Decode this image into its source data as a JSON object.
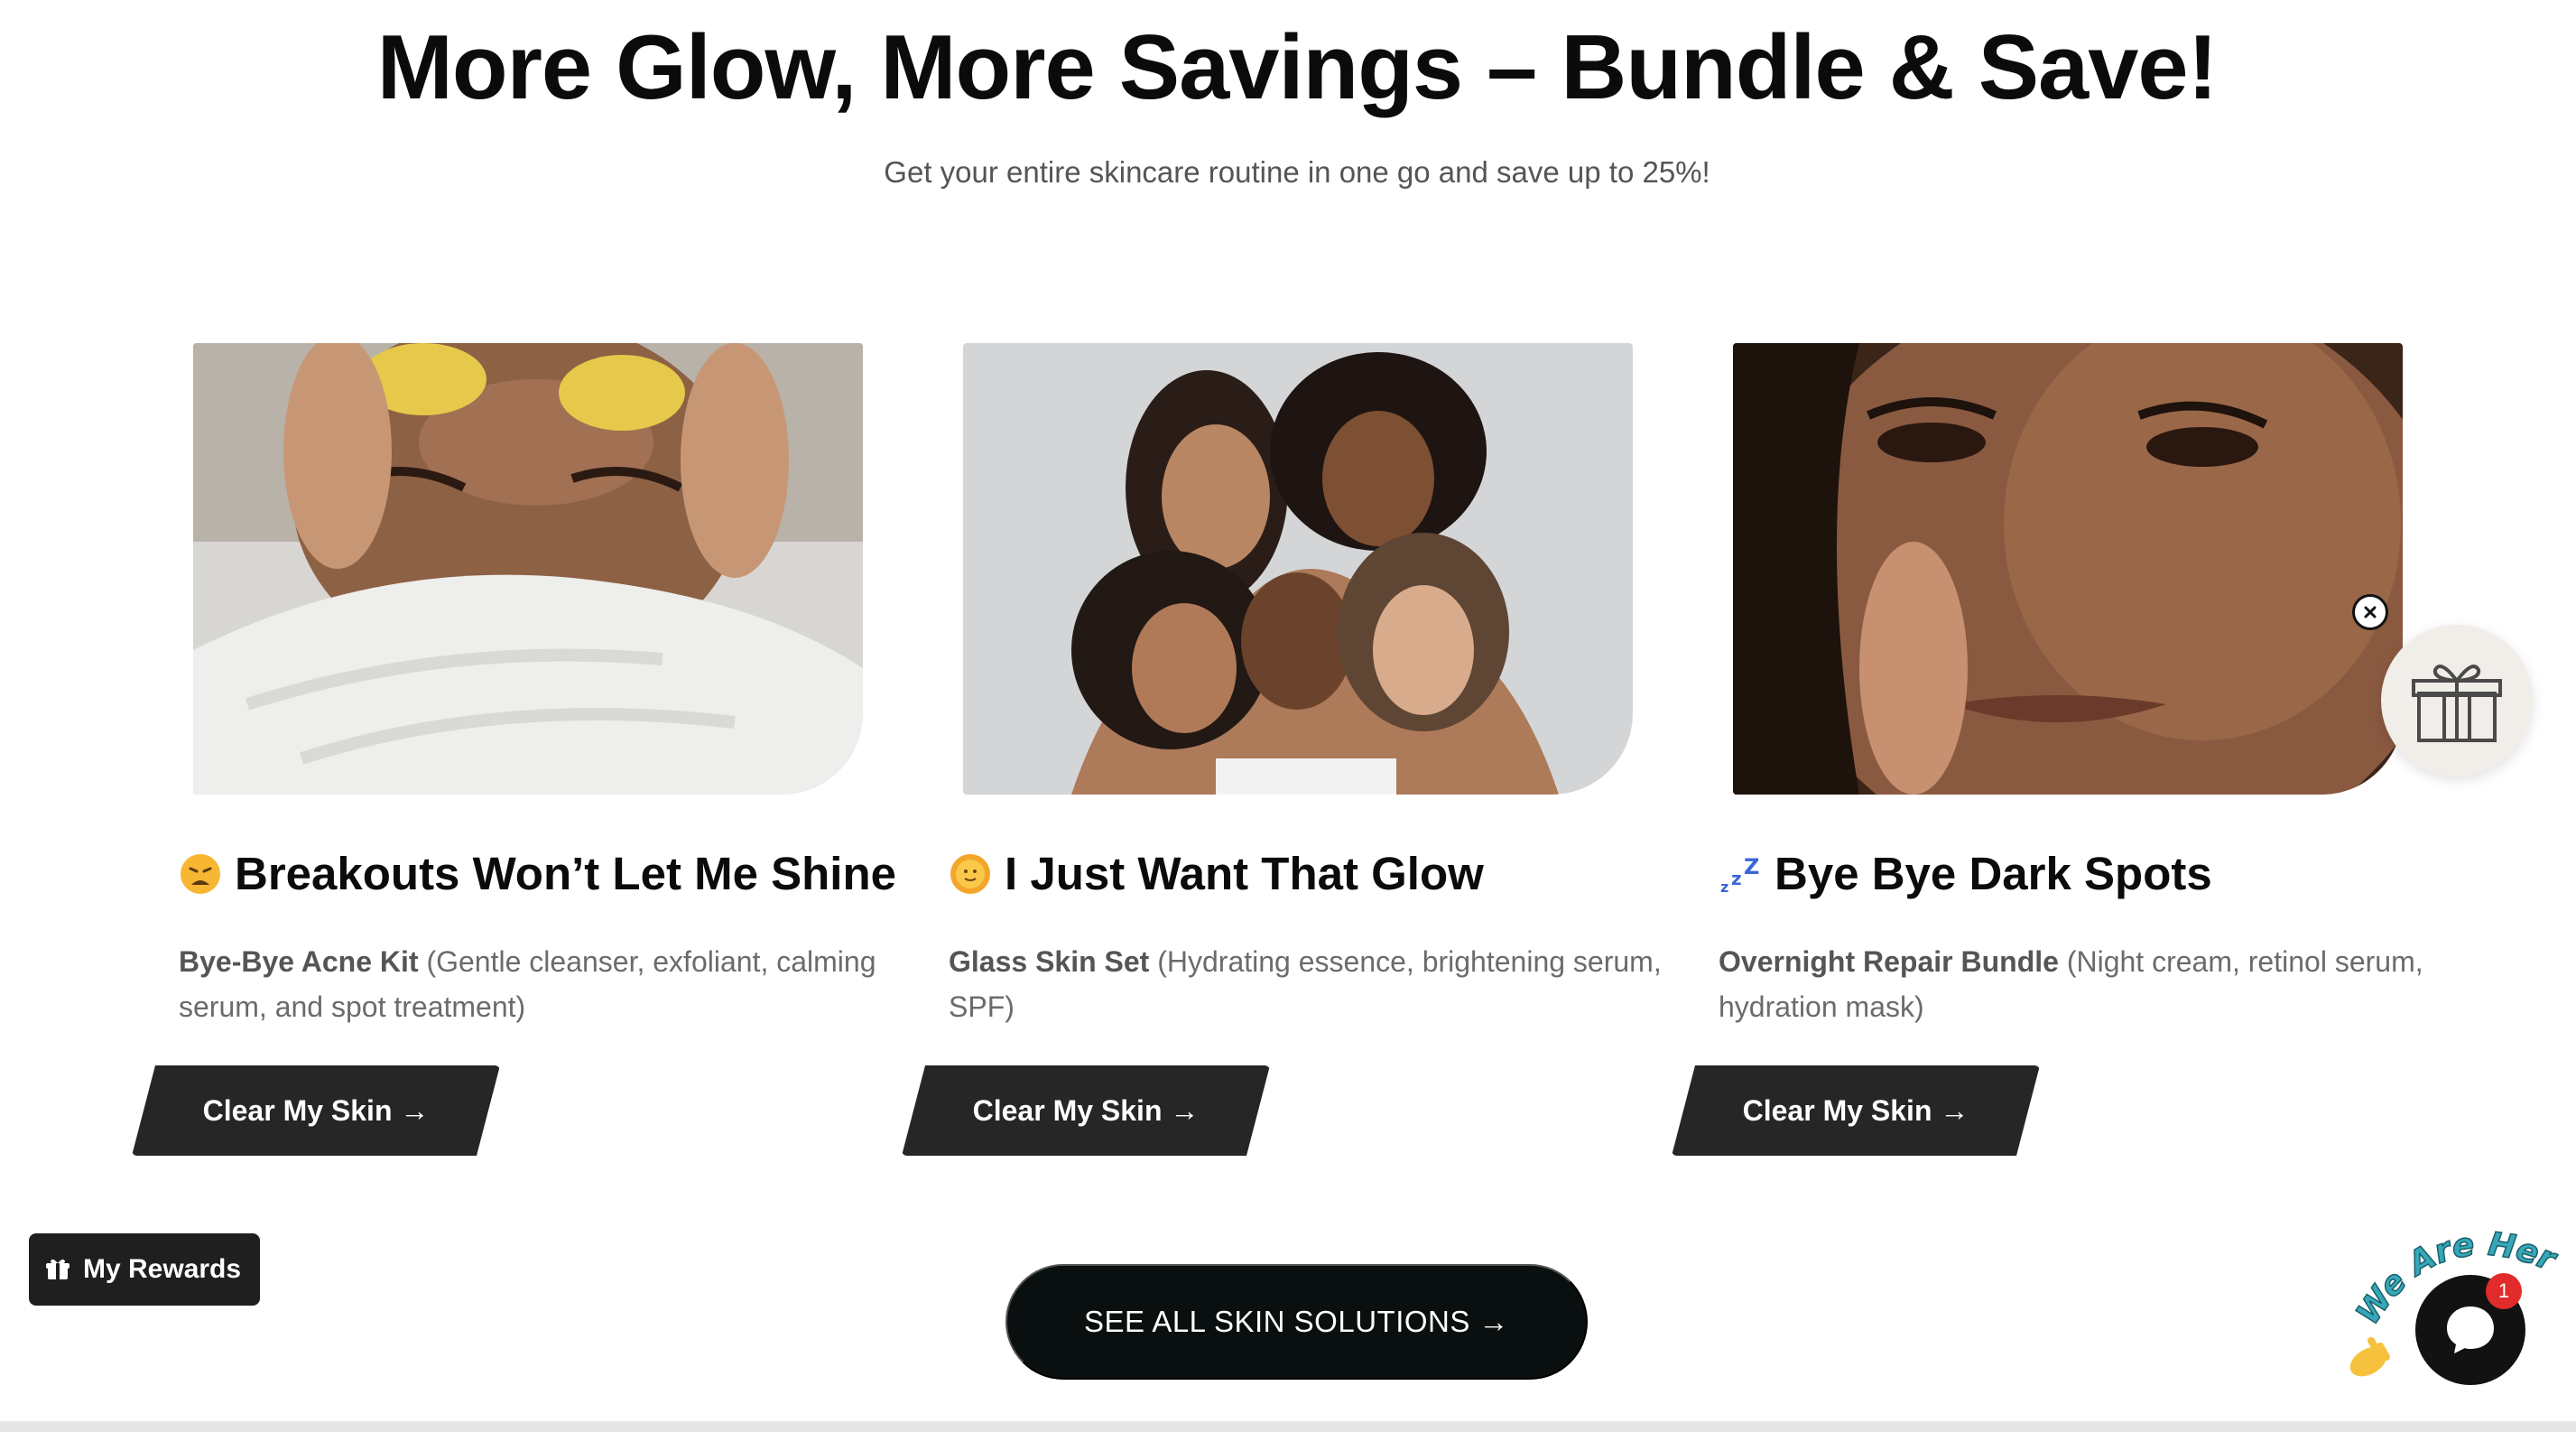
{
  "header": {
    "title": "More Glow, More Savings – Bundle & Save!",
    "subtitle": "Get your entire skincare routine in one go and save up to 25%!"
  },
  "cards": [
    {
      "emoji": "weary-face",
      "title": "Breakouts Won’t Let Me Shine",
      "product": "Bye-Bye Acne Kit",
      "desc": "(Gentle cleanser, exfoliant, calming serum, and spot treatment)",
      "button": "Clear My Skin →"
    },
    {
      "emoji": "sun-face",
      "title": "I Just Want That Glow",
      "product": "Glass Skin Set",
      "desc": "(Hydrating essence, brightening serum, SPF)",
      "button": "Clear My Skin →"
    },
    {
      "emoji": "zzz",
      "title": "Bye Bye Dark Spots",
      "product": "Overnight Repair Bundle",
      "desc": "(Night cream, retinol serum, hydration mask)",
      "button": "Clear My Skin →"
    }
  ],
  "cta": {
    "see_all": "SEE ALL SKIN SOLUTIONS →"
  },
  "rewards": {
    "label": "My Rewards"
  },
  "chat": {
    "tagline": "We Are Here!",
    "badge": "1"
  },
  "colors": {
    "button_dark": "#262626",
    "cta_dark": "#0a0f0f",
    "badge_red": "#e22b2b",
    "tagline": "#35a7b8"
  }
}
